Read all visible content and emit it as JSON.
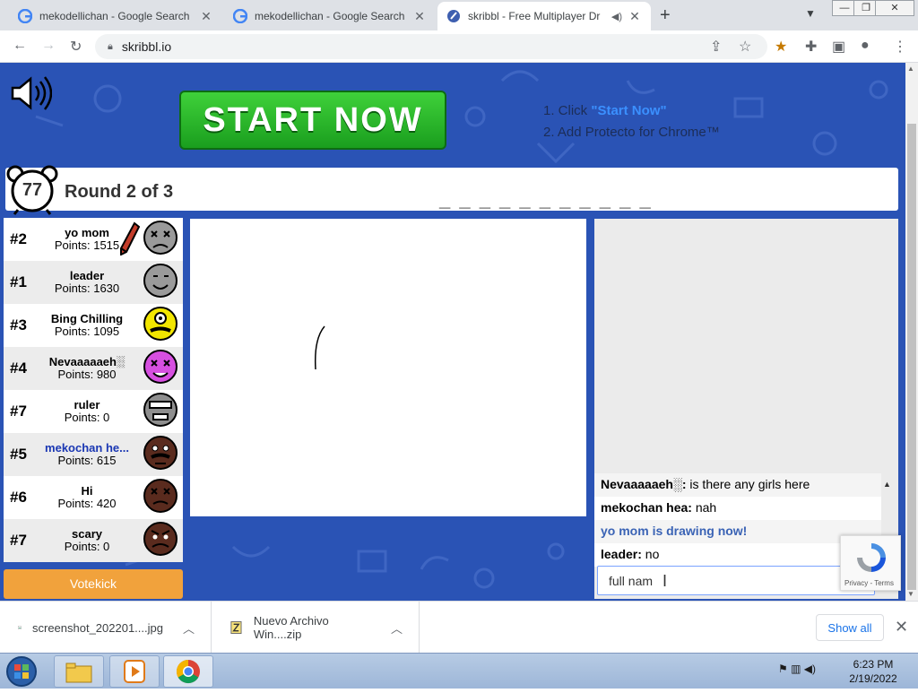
{
  "browser": {
    "tabs": [
      {
        "title": "mekodellichan - Google Search",
        "active": false
      },
      {
        "title": "mekodellichan - Google Search",
        "active": false
      },
      {
        "title": "skribbl - Free Multiplayer Dr",
        "active": true
      }
    ],
    "url": "skribbl.io"
  },
  "ad": {
    "button": "START NOW",
    "step1_prefix": "1. Click ",
    "step1_link": "\"Start Now\"",
    "step2": "2. Add Protecto for Chrome™"
  },
  "game": {
    "timer": "77",
    "round": "Round 2 of 3",
    "word_hint": "_ _ _ _ _   _ _ _ _ _ _"
  },
  "players": [
    {
      "rank": "#2",
      "name": "yo mom",
      "points": "Points: 1515",
      "color": "#9a9a9a",
      "drawing": true,
      "me": false
    },
    {
      "rank": "#1",
      "name": "leader",
      "points": "Points: 1630",
      "color": "#9a9a9a",
      "drawing": false,
      "me": false
    },
    {
      "rank": "#3",
      "name": "Bing Chilling",
      "points": "Points: 1095",
      "color": "#f2e600",
      "drawing": false,
      "me": false
    },
    {
      "rank": "#4",
      "name": "Nevaaaaaeh░",
      "points": "Points: 980",
      "color": "#d64fe0",
      "drawing": false,
      "me": false
    },
    {
      "rank": "#7",
      "name": "ruler",
      "points": "Points: 0",
      "color": "#8e8e8e",
      "drawing": false,
      "me": false
    },
    {
      "rank": "#5",
      "name": "mekochan he...",
      "points": "Points: 615",
      "color": "#5a2b1e",
      "drawing": false,
      "me": true
    },
    {
      "rank": "#6",
      "name": "Hi",
      "points": "Points: 420",
      "color": "#5a2b1e",
      "drawing": false,
      "me": false
    },
    {
      "rank": "#7",
      "name": "scary",
      "points": "Points: 0",
      "color": "#5a2b1e",
      "drawing": false,
      "me": false
    }
  ],
  "votekick": "Votekick",
  "chat": {
    "messages": [
      {
        "sender": "Nevaaaaaeh░:",
        "text": " is there any girls here",
        "system": false
      },
      {
        "sender": "mekochan hea:",
        "text": " nah",
        "system": false
      },
      {
        "sender": "",
        "text": "yo mom is drawing now!",
        "system": true
      },
      {
        "sender": "leader:",
        "text": " no",
        "system": false
      }
    ],
    "input_value": "full nam",
    "recaptcha_label": "Privacy - Terms"
  },
  "downloads": [
    {
      "name": "screenshot_202201....jpg"
    },
    {
      "name": "Nuevo Archivo Win....zip"
    }
  ],
  "show_all": "Show all",
  "taskbar": {
    "time": "6:23 PM",
    "date": "2/19/2022"
  }
}
